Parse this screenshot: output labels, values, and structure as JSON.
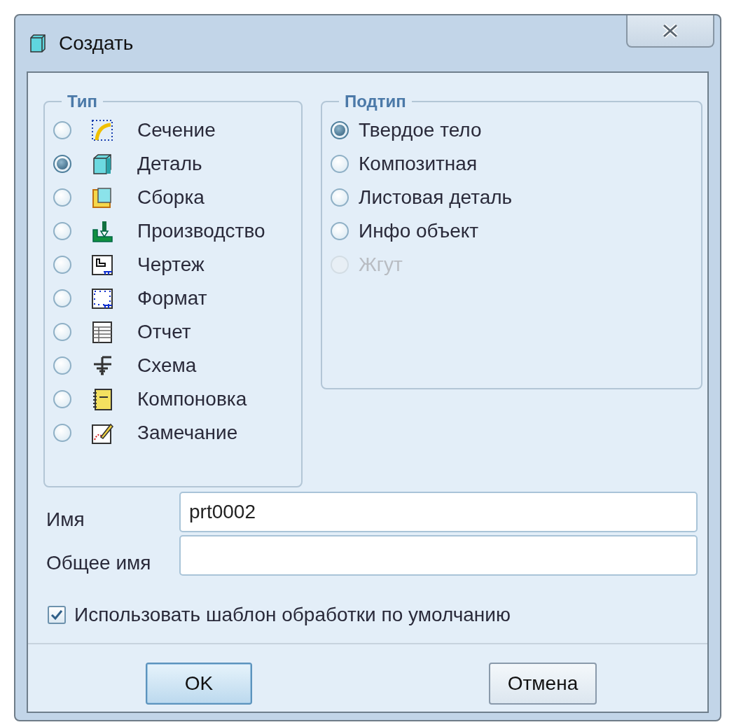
{
  "window": {
    "title": "Создать"
  },
  "type_group": {
    "title": "Тип",
    "items": [
      {
        "label": "Сечение",
        "kind": "section",
        "selected": false
      },
      {
        "label": "Деталь",
        "kind": "part",
        "selected": true
      },
      {
        "label": "Сборка",
        "kind": "assembly",
        "selected": false
      },
      {
        "label": "Производство",
        "kind": "manufacturing",
        "selected": false
      },
      {
        "label": "Чертеж",
        "kind": "drawing",
        "selected": false
      },
      {
        "label": "Формат",
        "kind": "format",
        "selected": false
      },
      {
        "label": "Отчет",
        "kind": "report",
        "selected": false
      },
      {
        "label": "Схема",
        "kind": "diagram",
        "selected": false
      },
      {
        "label": "Компоновка",
        "kind": "layout",
        "selected": false
      },
      {
        "label": "Замечание",
        "kind": "markup",
        "selected": false
      }
    ]
  },
  "subtype_group": {
    "title": "Подтип",
    "items": [
      {
        "label": "Твердое тело",
        "selected": true,
        "disabled": false
      },
      {
        "label": "Композитная",
        "selected": false,
        "disabled": false
      },
      {
        "label": "Листовая деталь",
        "selected": false,
        "disabled": false
      },
      {
        "label": "Инфо объект",
        "selected": false,
        "disabled": false
      },
      {
        "label": "Жгут",
        "selected": false,
        "disabled": true
      }
    ]
  },
  "fields": [
    {
      "label": "Имя",
      "value": "prt0002"
    },
    {
      "label": "Общее имя"
    }
  ],
  "default_template": {
    "label": "Использовать шаблон обработки по умолчанию",
    "checked": true
  },
  "buttons": [
    {
      "label": "OK",
      "default": true
    },
    {
      "label": "Отмена",
      "default": false
    }
  ]
}
